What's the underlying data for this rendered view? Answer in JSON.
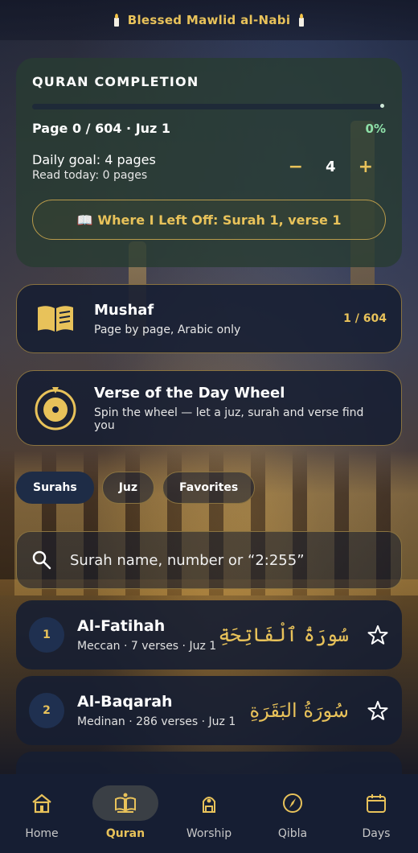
{
  "banner": {
    "text": "Blessed Mawlid al-Nabi"
  },
  "progress": {
    "title": "QURAN COMPLETION",
    "fraction": 0,
    "page_text": "Page 0 / 604 · Juz 1",
    "percent": "0%",
    "daily_goal": "Daily goal: 4 pages",
    "read_today": "Read today: 0 pages",
    "minus": "−",
    "plus": "+",
    "goal_value": "4",
    "resume_icon": "📖",
    "resume_label": "Where I Left Off: Surah 1, verse 1"
  },
  "mushaf": {
    "title": "Mushaf",
    "subtitle": "Page by page, Arabic only",
    "count": "1 / 604",
    "icon": "open-book-icon"
  },
  "wheel": {
    "title": "Verse of the Day Wheel",
    "subtitle": "Spin the wheel — let a juz, surah and verse find you",
    "icon": "wheel-icon"
  },
  "tabs": {
    "surahs": "Surahs",
    "juz": "Juz",
    "favorites": "Favorites"
  },
  "search": {
    "placeholder": "Surah name, number or “2:255”"
  },
  "surahs": [
    {
      "number": "1",
      "name": "Al-Fatihah",
      "meta": "Meccan · 7 verses · Juz 1",
      "arabic": "سُورَةُ ٱلْفَاتِحَةِ"
    },
    {
      "number": "2",
      "name": "Al-Baqarah",
      "meta": "Medinan · 286 verses · Juz 1",
      "arabic": "سُورَةُ البَقَرَةِ"
    }
  ],
  "nav": {
    "home": "Home",
    "quran": "Quran",
    "worship": "Worship",
    "qibla": "Qibla",
    "days": "Days"
  },
  "colors": {
    "accent": "#e8c25a",
    "card": "#16203a",
    "progress_card": "#28443a",
    "percent": "#8ee0a8"
  }
}
